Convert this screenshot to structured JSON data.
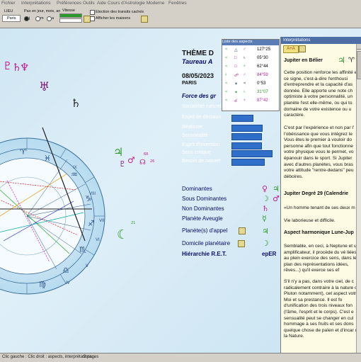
{
  "menu": [
    "Fichier",
    "Interprétations",
    "Préférences",
    "Outils",
    "Aide",
    "Cours d'Astrologie Moderne",
    "Fenêtres"
  ],
  "toolbar": {
    "lieu_label": "LIEU",
    "city": "Paris",
    "step_label": "Pas en jour, mois, an",
    "radio_labels": [
      "j",
      "m",
      "a"
    ],
    "speed_label": "Vitesse",
    "check1": "Election des transits cachés",
    "check2": "Afficher les maisons"
  },
  "chart": {
    "house_numbers": [
      "IX",
      "VIII",
      "VII",
      "VI",
      "V",
      "IV"
    ],
    "planet_degrees": [
      "6R",
      "26",
      "21"
    ]
  },
  "theme": {
    "title": "THÈME D",
    "name": "Taureau A",
    "date": "08/05/2023",
    "place": "PARIS",
    "forces_label": "Force des gr"
  },
  "traits": [
    {
      "label": "Sociabilité naturel",
      "value": 0.3
    },
    {
      "label": "Esprit de décision",
      "value": 0.42
    },
    {
      "label": "Réalisme",
      "value": 0.62
    },
    {
      "label": "Sensorialité",
      "value": 0.6
    },
    {
      "label": "Esprit d'invention",
      "value": 0.6
    },
    {
      "label": "Sens critique",
      "value": 0.82
    },
    {
      "label": "Besoin de naturel",
      "value": 0.66
    }
  ],
  "dominants": {
    "labels": [
      "Dominantes",
      "Sous Dominantes",
      "Non Dominantes",
      "Planète Aveugle",
      "Planète(s) d'appel",
      "Domicile planétaire",
      "Hiérarchie R.E.T."
    ],
    "ret_value": "epER"
  },
  "aspects": {
    "title": "Liste des aspects",
    "rows": [
      {
        "a": "♃",
        "b": "△",
        "c": "♂",
        "val": "127°25"
      },
      {
        "a": "♃",
        "b": "□",
        "c": "♄",
        "val": "05°30"
      },
      {
        "a": "♃",
        "b": "□",
        "c": "♆",
        "val": "62°44"
      },
      {
        "a": "♀",
        "b": "☍",
        "c": "♂",
        "val": "84°59"
      },
      {
        "a": "♃",
        "b": "✶",
        "c": "♃",
        "val": "0°53"
      },
      {
        "a": "♃",
        "b": "✶",
        "c": "♄",
        "val": "31°07"
      },
      {
        "a": "♃",
        "b": "☌",
        "c": "♆",
        "val": "87°42"
      }
    ]
  },
  "interpretations": {
    "title": "Interprétations",
    "heading1": "Jupiter en Bélier",
    "p1": "Cette position renforce les affinité et ce signe, c'est-à-dire l'enthousi d'entreprendre et la capacité d'as donnée. Elle apporte une note ch optimiste à votre personnalité, un planète l'est elle-même, ou qui to domaine de votre existence ou u caractère.",
    "p2": "C'est par l'expérience et non par l' l'obéissance que vous intégrez le Vous êtes le premier à vouloir do personne afin que tout fonctionne votre physique vous le permet, vo épanouir dans le sport. Si Jupiter avec d'autres planètes, vous bras votre attitude \"rentre-dedans\" peu déboires.",
    "heading2": "Jupiter Degré 29 (Calendrie",
    "quote": "«Un homme tenant de ses deux m",
    "p3": "Vie laborieuse et difficile.",
    "heading3": "Aspect harmonique Lune-Jup",
    "p4": "Semblable, en ceci, à Neptune et un amplificateur, il procède du vé liées au plein exercice des sens, dans le plan des représentations idées, rêves...) qu'il exerce ses ef",
    "p5": "S'il n'y a pas, dans votre ciel, de c radicalement contraire à la nature ou Pluton notamment), cet aspect votre Moi et sa prestance. Il est fo d'unification des trois niveaux fon (l'âme, l'esprit et le corps). C'est e sensualité peut se changer en cul hommage à ses fruits et ses dons quelque chose de païen et d'incar de la Nature."
  },
  "status": {
    "left": "Clic gauche : Clic droit : aspects, interprétations...",
    "pages": "3 pages"
  },
  "colors": {
    "accent": "#2f6fc9",
    "interp_bg": "#fdfbe3",
    "chart_bg": "#cfe6f3"
  }
}
